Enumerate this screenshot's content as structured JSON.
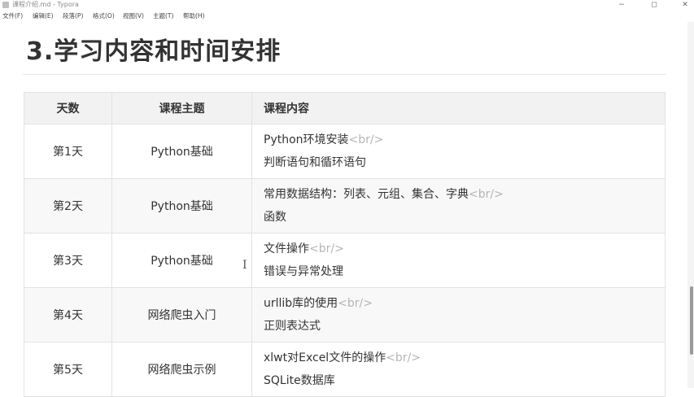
{
  "window": {
    "title": "课程介绍.md - Typora",
    "controls": {
      "minimize": "−",
      "maximize": "◻",
      "close": "✕"
    }
  },
  "menubar": [
    "文件(F)",
    "编辑(E)",
    "段落(P)",
    "格式(O)",
    "视图(V)",
    "主题(T)",
    "帮助(H)"
  ],
  "document": {
    "heading": "3.学习内容和时间安排",
    "table": {
      "headers": [
        "天数",
        "课程主题",
        "课程内容"
      ],
      "rows": [
        {
          "day": "第1天",
          "topic": "Python基础",
          "line1": "Python环境安装",
          "line2": "判断语句和循环语句"
        },
        {
          "day": "第2天",
          "topic": "Python基础",
          "line1": "常用数据结构：列表、元组、集合、字典",
          "line2": "函数"
        },
        {
          "day": "第3天",
          "topic": "Python基础",
          "line1": "文件操作",
          "line2": "错误与异常处理"
        },
        {
          "day": "第4天",
          "topic": "网络爬虫入门",
          "line1": "urllib库的使用",
          "line2": "正则表达式"
        },
        {
          "day": "第5天",
          "topic": "网络爬虫示例",
          "line1": "xlwt对Excel文件的操作",
          "line2": "SQLite数据库"
        }
      ],
      "br_tag": "<br/>"
    }
  },
  "cursor": {
    "glyph": "I"
  }
}
